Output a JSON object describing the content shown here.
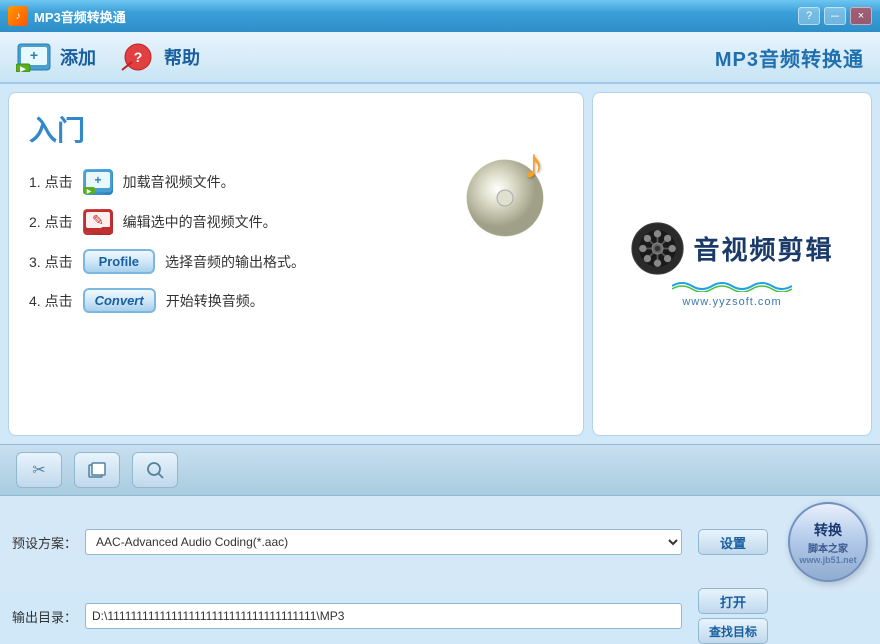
{
  "window": {
    "title": "MP3音频转换通",
    "icon": "♪"
  },
  "titlebar": {
    "help_btn": "?",
    "minimize_btn": "－",
    "close_btn": "×"
  },
  "toolbar": {
    "add_label": "添加",
    "help_label": "帮助",
    "app_title": "MP3音频转换通"
  },
  "getting_started": {
    "title": "入门",
    "step1_num": "1. 点击",
    "step1_text": "加载音视频文件。",
    "step2_num": "2. 点击",
    "step2_text": "编辑选中的音视频文件。",
    "step3_num": "3. 点击",
    "step3_profile_btn": "Profile",
    "step3_text": "选择音频的输出格式。",
    "step4_num": "4. 点击",
    "step4_convert_btn": "Convert",
    "step4_text": "开始转换音频。"
  },
  "brand": {
    "main_text": "音视频剪辑",
    "sub_text": "www.yyzsoft.com"
  },
  "bottom_controls": {
    "cut_icon": "✂",
    "copy_icon": "⬜",
    "search_icon": "🔍"
  },
  "bottom_bar": {
    "preset_label": "预设方案：",
    "preset_value": "AAC-Advanced Audio Coding(*.aac)",
    "output_label": "输出目录：",
    "output_value": "D:\\111111111111111111111111111111111111\\MP3",
    "settings_btn": "设置",
    "open_btn": "打开",
    "find_target_btn": "查找目标",
    "convert_btn_line1": "转换",
    "convert_btn_line2": "脚本之家"
  },
  "watermark": {
    "text": "www.jb51.net"
  }
}
